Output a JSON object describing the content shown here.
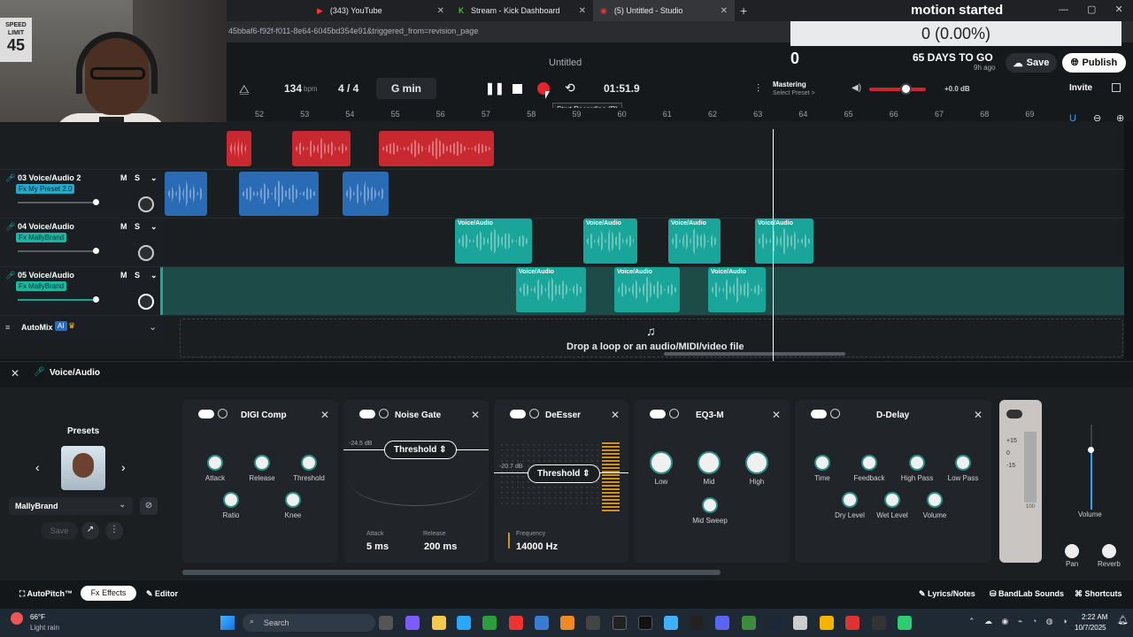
{
  "browser": {
    "tabs": [
      {
        "label": "(343) YouTube"
      },
      {
        "label": "Stream - Kick Dashboard"
      },
      {
        "label": "(5) Untitled - Studio"
      }
    ],
    "url": "45bbaf6-f92f-f011-8e64-6045bd354e91&triggered_from=revision_page"
  },
  "webcam": {
    "sign_top": "SPEED LIMIT",
    "sign_num": "45"
  },
  "overlay": {
    "title": "motion started",
    "amount": "0 (0.00%)",
    "count": "0",
    "days": "65 DAYS TO GO",
    "ago": "9h ago"
  },
  "project": {
    "title": "Untitled",
    "bpm": "134",
    "bpm_unit": "bpm",
    "sig": "4 / 4",
    "key": "G min",
    "time": "01:51.9",
    "tooltip": "Start Recording (R)",
    "mastering": "Mastering",
    "preset": "Select Preset >",
    "db": "+0.0 dB",
    "save": "Save",
    "publish": "Publish",
    "invite": "Invite"
  },
  "ruler": [
    "52",
    "53",
    "54",
    "55",
    "56",
    "57",
    "58",
    "59",
    "60",
    "61",
    "62",
    "63",
    "64",
    "65",
    "66",
    "67",
    "68",
    "69"
  ],
  "tracks": [
    {
      "name": "03 Voice/Audio 2",
      "fx": "Fx My Preset 2.0"
    },
    {
      "name": "04 Voice/Audio",
      "fx": "Fx MallyBrand"
    },
    {
      "name": "05 Voice/Audio",
      "fx": "Fx MallyBrand"
    }
  ],
  "clip_label": "Voice/Audio",
  "ms": {
    "m": "M",
    "s": "S"
  },
  "automix": {
    "label": "AutoMix",
    "ai": "AI"
  },
  "drop": "Drop a loop or an audio/MIDI/video file",
  "panel": {
    "title": "Voice/Audio",
    "presets": "Presets",
    "preset_name": "MallyBrand",
    "save": "Save"
  },
  "effects": [
    {
      "name": "DIGI Comp",
      "params": [
        "Attack",
        "Release",
        "Threshold",
        "Ratio",
        "Knee"
      ]
    },
    {
      "name": "Noise Gate",
      "threshold": "Threshold",
      "db": "-24.5 dB",
      "attack_l": "Attack",
      "attack": "5 ms",
      "release_l": "Release",
      "release": "200 ms"
    },
    {
      "name": "DeEsser",
      "threshold": "Threshold",
      "db": "-20.7 dB",
      "freq_l": "Frequency",
      "freq": "14000 Hz"
    },
    {
      "name": "EQ3-M",
      "params": [
        "Low",
        "Mid",
        "High",
        "Mid Sweep"
      ]
    },
    {
      "name": "D-Delay",
      "params": [
        "Time",
        "Feedback",
        "High Pass",
        "Low Pass",
        "Dry Level",
        "Wet Level",
        "Volume"
      ]
    }
  ],
  "meter": {
    "l1": "+15",
    "l2": "0",
    "l3": "-15",
    "l4": "100",
    "volume": "Volume",
    "pan": "Pan",
    "reverb": "Reverb"
  },
  "footer": {
    "autopitch": "AutoPitch™",
    "effects": "Effects",
    "editor": "Editor",
    "lyrics": "Lyrics/Notes",
    "sounds": "BandLab Sounds",
    "shortcuts": "Shortcuts"
  },
  "taskbar": {
    "temp": "66°F",
    "weather": "Light rain",
    "search": "Search",
    "time": "2:22 AM",
    "date": "10/7/2025"
  },
  "colors": {
    "record": "#e5252b",
    "teal": "#1aa59a",
    "red": "#c8282f",
    "blue": "#2a6bb5"
  }
}
